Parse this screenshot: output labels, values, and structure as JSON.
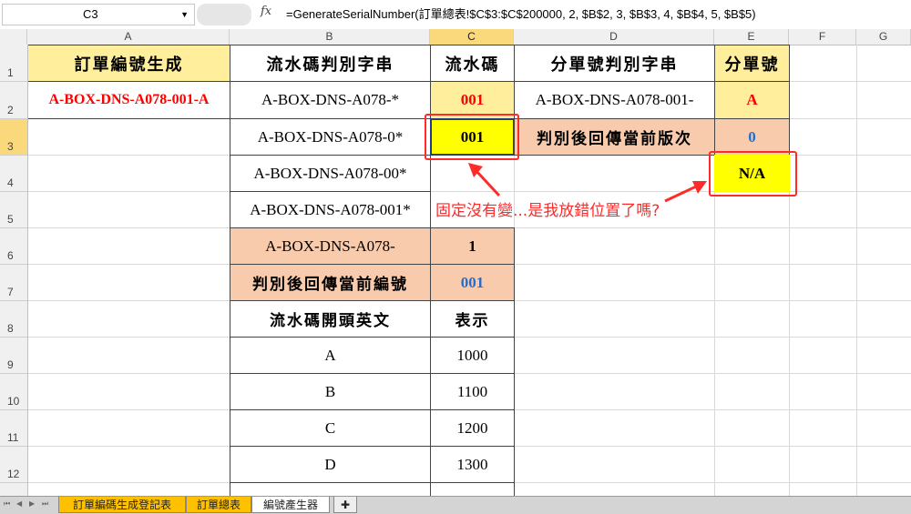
{
  "formula_bar": {
    "name_box": "C3",
    "fx_label": "fx",
    "formula": "=GenerateSerialNumber(訂單總表!$C$3:$C$200000, 2, $B$2, 3, $B$3, 4, $B$4, 5, $B$5)"
  },
  "columns": [
    "A",
    "B",
    "C",
    "D",
    "E",
    "F",
    "G"
  ],
  "rows": [
    "1",
    "2",
    "3",
    "4",
    "5",
    "6",
    "7",
    "8",
    "9",
    "10",
    "11",
    "12"
  ],
  "cells": {
    "a1": "訂單編號生成",
    "a2": "A-BOX-DNS-A078-001-A",
    "b1": "流水碼判別字串",
    "b2": "A-BOX-DNS-A078-*",
    "b3": "A-BOX-DNS-A078-0*",
    "b4": "A-BOX-DNS-A078-00*",
    "b5": "A-BOX-DNS-A078-001*",
    "b6": "A-BOX-DNS-A078-",
    "b7": "判別後回傳當前編號",
    "b8": "流水碼開頭英文",
    "b9": "A",
    "b10": "B",
    "b11": "C",
    "b12": "D",
    "c1": "流水碼",
    "c2": "001",
    "c3": "001",
    "c6": "1",
    "c7": "001",
    "c8": "表示",
    "c9": "1000",
    "c10": "1100",
    "c11": "1200",
    "c12": "1300",
    "d1": "分單號判別字串",
    "d2": "A-BOX-DNS-A078-001-",
    "d3": "判別後回傳當前版次",
    "e1": "分單號",
    "e2": "A",
    "e3": "0",
    "e4": "N/A"
  },
  "annotation": "固定沒有變...是我放錯位置了嗎?",
  "sheet_tabs": [
    "訂單編碼生成登記表",
    "訂單總表",
    "編號產生器"
  ],
  "colors": {
    "header_yellow": "#ffef9c",
    "peach": "#f8cbad",
    "bright_yellow": "#ffff00",
    "red_text": "#ff0000",
    "blue_text": "#1f6dd0",
    "callout": "#ff2a2a"
  }
}
